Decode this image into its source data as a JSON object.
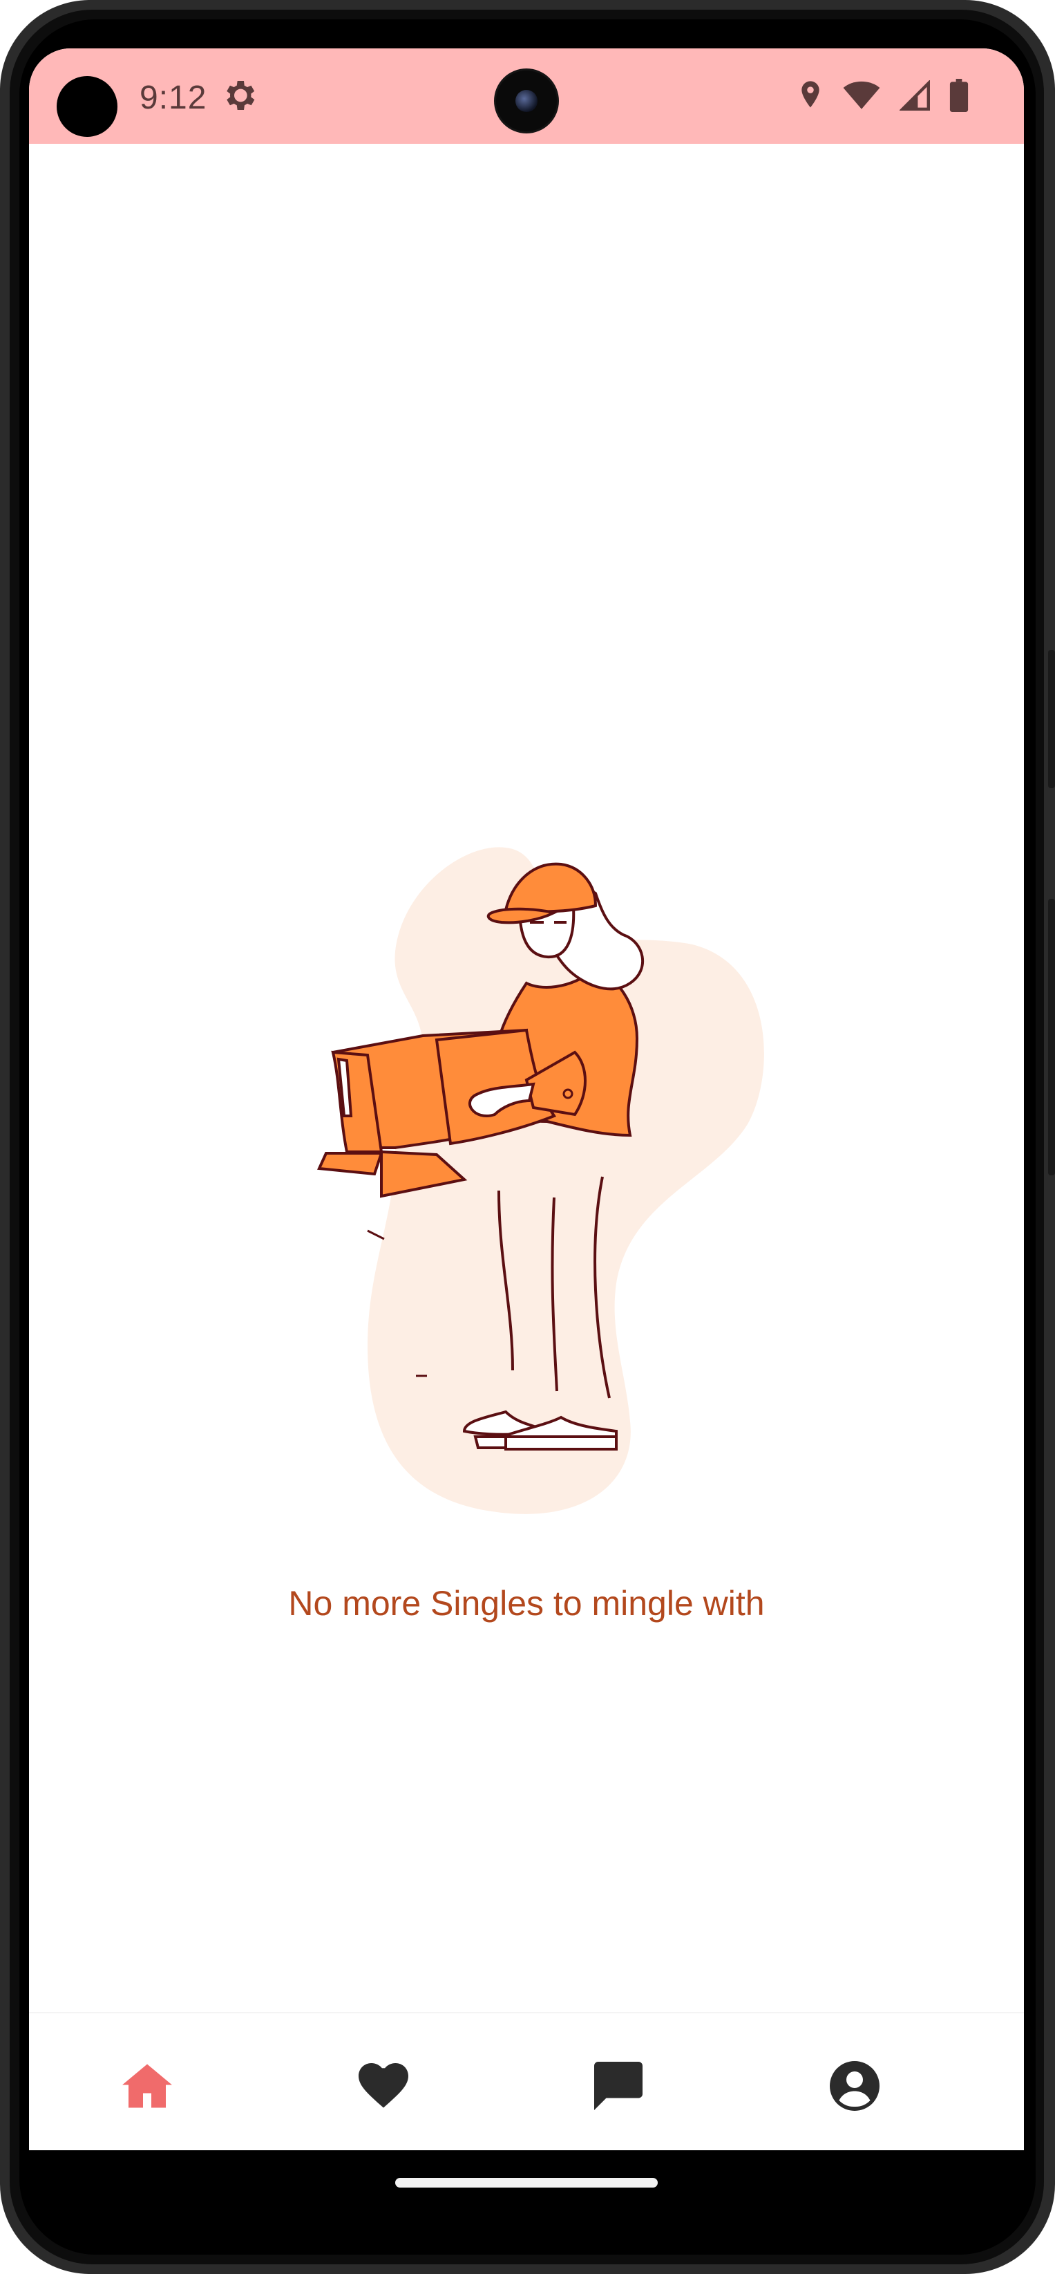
{
  "status_bar": {
    "time": "9:12",
    "icons": [
      "settings-gear-icon",
      "location-icon",
      "wifi-icon",
      "signal-icon",
      "battery-icon"
    ],
    "background": "#ffb8b8"
  },
  "main": {
    "empty_state": {
      "illustration": "person-holding-box",
      "message": "No more Singles to mingle with",
      "message_color": "#b3481d"
    }
  },
  "bottom_nav": {
    "items": [
      {
        "icon": "home-icon",
        "active": true,
        "color": "#f06b6b"
      },
      {
        "icon": "heart-icon",
        "active": false,
        "color": "#2b2b2b"
      },
      {
        "icon": "chat-icon",
        "active": false,
        "color": "#2b2b2b"
      },
      {
        "icon": "account-icon",
        "active": false,
        "color": "#2b2b2b"
      }
    ]
  }
}
